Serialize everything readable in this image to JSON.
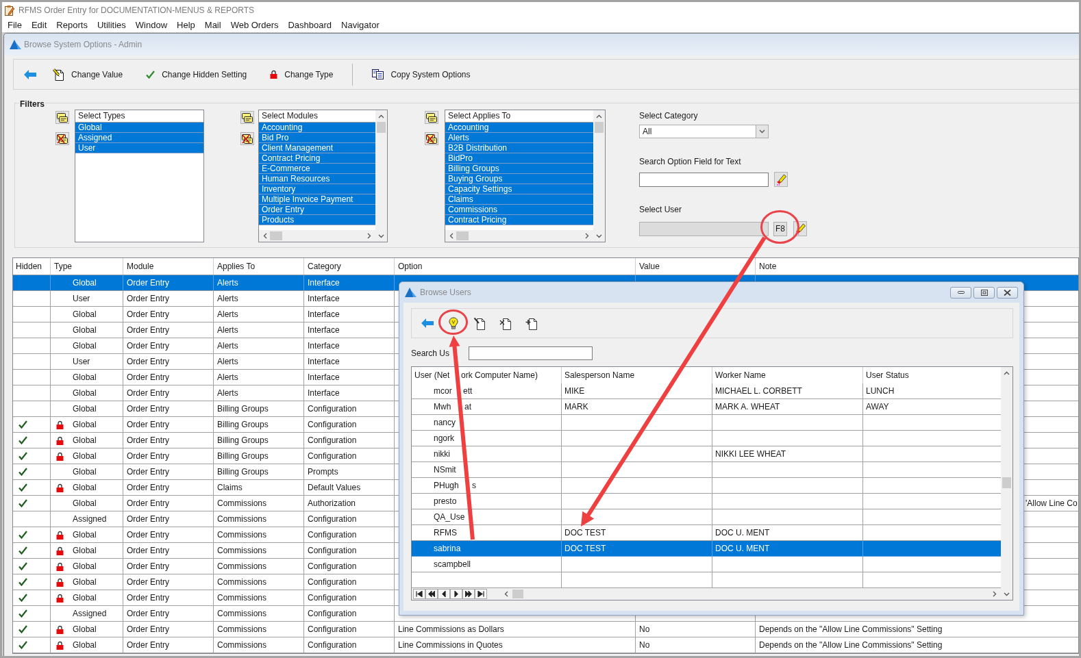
{
  "app": {
    "title": "RFMS Order Entry for DOCUMENTATION-MENUS & REPORTS"
  },
  "menu": [
    "File",
    "Edit",
    "Reports",
    "Utilities",
    "Window",
    "Help",
    "Mail",
    "Web Orders",
    "Dashboard",
    "Navigator"
  ],
  "window": {
    "title": "Browse System Options - Admin"
  },
  "toolbar": {
    "groups": [
      [
        {
          "kind": "back"
        },
        {
          "kind": "edit",
          "label": "Change Value"
        },
        {
          "kind": "hide",
          "label": "Change Hidden Setting"
        },
        {
          "kind": "lock",
          "label": "Change Type"
        }
      ],
      [
        {
          "kind": "copy",
          "label": "Copy System Options"
        }
      ]
    ]
  },
  "filters": {
    "title": "Filters",
    "lists": [
      {
        "header": "Select Types",
        "items": [
          {
            "label": "Global",
            "selected": true
          },
          {
            "label": "Assigned",
            "selected": true
          },
          {
            "label": "User",
            "selected": true
          }
        ]
      },
      {
        "header": "Select Modules",
        "scrollbars": true,
        "items": [
          {
            "label": "Accounting",
            "selected": true
          },
          {
            "label": "Bid Pro",
            "selected": true
          },
          {
            "label": "Client Management",
            "selected": true
          },
          {
            "label": "Contract Pricing",
            "selected": true
          },
          {
            "label": "E-Commerce",
            "selected": true
          },
          {
            "label": "Human Resources",
            "selected": true
          },
          {
            "label": "Inventory",
            "selected": true
          },
          {
            "label": "Multiple Invoice Payment",
            "selected": true
          },
          {
            "label": "Order Entry",
            "selected": true
          },
          {
            "label": "Products",
            "selected": true
          }
        ]
      },
      {
        "header": "Select Applies To",
        "scrollbars": true,
        "items": [
          {
            "label": "Accounting",
            "selected": true
          },
          {
            "label": "Alerts",
            "selected": true
          },
          {
            "label": "B2B Distribution",
            "selected": true
          },
          {
            "label": "BidPro",
            "selected": true
          },
          {
            "label": "Billing Groups",
            "selected": true
          },
          {
            "label": "Buying Groups",
            "selected": true
          },
          {
            "label": "Capacity Settings",
            "selected": true
          },
          {
            "label": "Claims",
            "selected": true
          },
          {
            "label": "Commissions",
            "selected": true
          },
          {
            "label": "Contract Pricing",
            "selected": true
          }
        ]
      }
    ],
    "category": {
      "label": "Select Category",
      "value": "All"
    },
    "search": {
      "label": "Search Option Field for Text"
    },
    "user": {
      "label": "Select User",
      "button": "F8",
      "disabled": true
    }
  },
  "table": {
    "columns": [
      "Hidden",
      "Type",
      "Module",
      "Applies To",
      "Category",
      "Option",
      "Value",
      "Note"
    ],
    "rows": [
      {
        "hidden": false,
        "locked": false,
        "type": "Global",
        "module": "Order Entry",
        "applies_to": "Alerts",
        "category": "Interface",
        "selected": true
      },
      {
        "hidden": false,
        "locked": false,
        "type": "User",
        "module": "Order Entry",
        "applies_to": "Alerts",
        "category": "Interface",
        "selected": false
      },
      {
        "hidden": false,
        "locked": false,
        "type": "Global",
        "module": "Order Entry",
        "applies_to": "Alerts",
        "category": "Interface",
        "selected": false
      },
      {
        "hidden": false,
        "locked": false,
        "type": "Global",
        "module": "Order Entry",
        "applies_to": "Alerts",
        "category": "Interface",
        "selected": false
      },
      {
        "hidden": false,
        "locked": false,
        "type": "Global",
        "module": "Order Entry",
        "applies_to": "Alerts",
        "category": "Interface",
        "selected": false
      },
      {
        "hidden": false,
        "locked": false,
        "type": "User",
        "module": "Order Entry",
        "applies_to": "Alerts",
        "category": "Interface",
        "selected": false
      },
      {
        "hidden": false,
        "locked": false,
        "type": "Global",
        "module": "Order Entry",
        "applies_to": "Alerts",
        "category": "Interface",
        "selected": false
      },
      {
        "hidden": false,
        "locked": false,
        "type": "Global",
        "module": "Order Entry",
        "applies_to": "Alerts",
        "category": "Interface",
        "selected": false
      },
      {
        "hidden": false,
        "locked": false,
        "type": "Global",
        "module": "Order Entry",
        "applies_to": "Billing Groups",
        "category": "Configuration",
        "selected": false
      },
      {
        "hidden": true,
        "locked": true,
        "type": "Global",
        "module": "Order Entry",
        "applies_to": "Billing Groups",
        "category": "Configuration",
        "selected": false
      },
      {
        "hidden": true,
        "locked": true,
        "type": "Global",
        "module": "Order Entry",
        "applies_to": "Billing Groups",
        "category": "Configuration",
        "selected": false
      },
      {
        "hidden": true,
        "locked": true,
        "type": "Global",
        "module": "Order Entry",
        "applies_to": "Billing Groups",
        "category": "Configuration",
        "selected": false
      },
      {
        "hidden": true,
        "locked": false,
        "type": "Global",
        "module": "Order Entry",
        "applies_to": "Billing Groups",
        "category": "Prompts",
        "selected": false
      },
      {
        "hidden": true,
        "locked": true,
        "type": "Global",
        "module": "Order Entry",
        "applies_to": "Claims",
        "category": "Default Values",
        "selected": false
      },
      {
        "hidden": true,
        "locked": false,
        "type": "Global",
        "module": "Order Entry",
        "applies_to": "Commissions",
        "category": "Authorization",
        "note": "'Allow Line Co",
        "selected": false
      },
      {
        "hidden": false,
        "locked": false,
        "type": "Assigned",
        "module": "Order Entry",
        "applies_to": "Commissions",
        "category": "Configuration",
        "selected": false
      },
      {
        "hidden": true,
        "locked": true,
        "type": "Global",
        "module": "Order Entry",
        "applies_to": "Commissions",
        "category": "Configuration",
        "selected": false
      },
      {
        "hidden": true,
        "locked": true,
        "type": "Global",
        "module": "Order Entry",
        "applies_to": "Commissions",
        "category": "Configuration",
        "selected": false
      },
      {
        "hidden": true,
        "locked": true,
        "type": "Global",
        "module": "Order Entry",
        "applies_to": "Commissions",
        "category": "Configuration",
        "selected": false
      },
      {
        "hidden": true,
        "locked": true,
        "type": "Global",
        "module": "Order Entry",
        "applies_to": "Commissions",
        "category": "Configuration",
        "selected": false
      },
      {
        "hidden": true,
        "locked": true,
        "type": "Global",
        "module": "Order Entry",
        "applies_to": "Commissions",
        "category": "Configuration",
        "selected": false
      },
      {
        "hidden": true,
        "locked": false,
        "type": "Assigned",
        "module": "Order Entry",
        "applies_to": "Commissions",
        "category": "Configuration",
        "selected": false
      },
      {
        "hidden": true,
        "locked": true,
        "type": "Global",
        "module": "Order Entry",
        "applies_to": "Commissions",
        "category": "Configuration",
        "option": "Line Commissions as Dollars",
        "value": "No",
        "note": "Depends on the \"Allow Line Commissions\" Setting",
        "selected": false
      },
      {
        "hidden": true,
        "locked": true,
        "type": "Global",
        "module": "Order Entry",
        "applies_to": "Commissions",
        "category": "Configuration",
        "option": "Line Commissions in Quotes",
        "value": "No",
        "note": "Depends on the \"Allow Line Commissions\" Setting",
        "selected": false
      }
    ]
  },
  "dialog": {
    "title": "Browse Users",
    "toolbar": [
      {
        "kind": "back"
      },
      {
        "kind": "bulb"
      },
      {
        "kind": "edit"
      },
      {
        "kind": "delete"
      },
      {
        "kind": "add"
      }
    ],
    "search": {
      "label": "Search Us"
    },
    "columns": [
      {
        "label": "User (Net",
        "label_after_arrow": "ork Computer Name)"
      },
      {
        "label": "Salesperson Name"
      },
      {
        "label": "Worker Name"
      },
      {
        "label": "User Status"
      }
    ],
    "rows": [
      {
        "user": "mcor",
        "user_after_arrow": "ett",
        "salesperson": "MIKE",
        "worker": "MICHAEL L. CORBETT",
        "status": "LUNCH",
        "selected": false
      },
      {
        "user": "Mwh",
        "user_after_arrow": "at",
        "salesperson": "MARK",
        "worker": "MARK A. WHEAT",
        "status": "AWAY",
        "selected": false
      },
      {
        "user": "nancy",
        "selected": false
      },
      {
        "user": "ngork",
        "selected": false
      },
      {
        "user": "nikki",
        "worker": "NIKKI LEE WHEAT",
        "selected": false
      },
      {
        "user": "NSmit",
        "selected": false
      },
      {
        "user": "PHugh",
        "user_after_arrow": "s",
        "selected": false
      },
      {
        "user": "presto",
        "selected": false
      },
      {
        "user": "QA_Use",
        "selected": false
      },
      {
        "user": "RFMS",
        "salesperson": "DOC TEST",
        "worker": "DOC U. MENT",
        "selected": false
      },
      {
        "user": "sabrina",
        "salesperson": "DOC TEST",
        "worker": "DOC U. MENT",
        "selected": true
      },
      {
        "user": "scampbell",
        "selected": false
      }
    ]
  }
}
